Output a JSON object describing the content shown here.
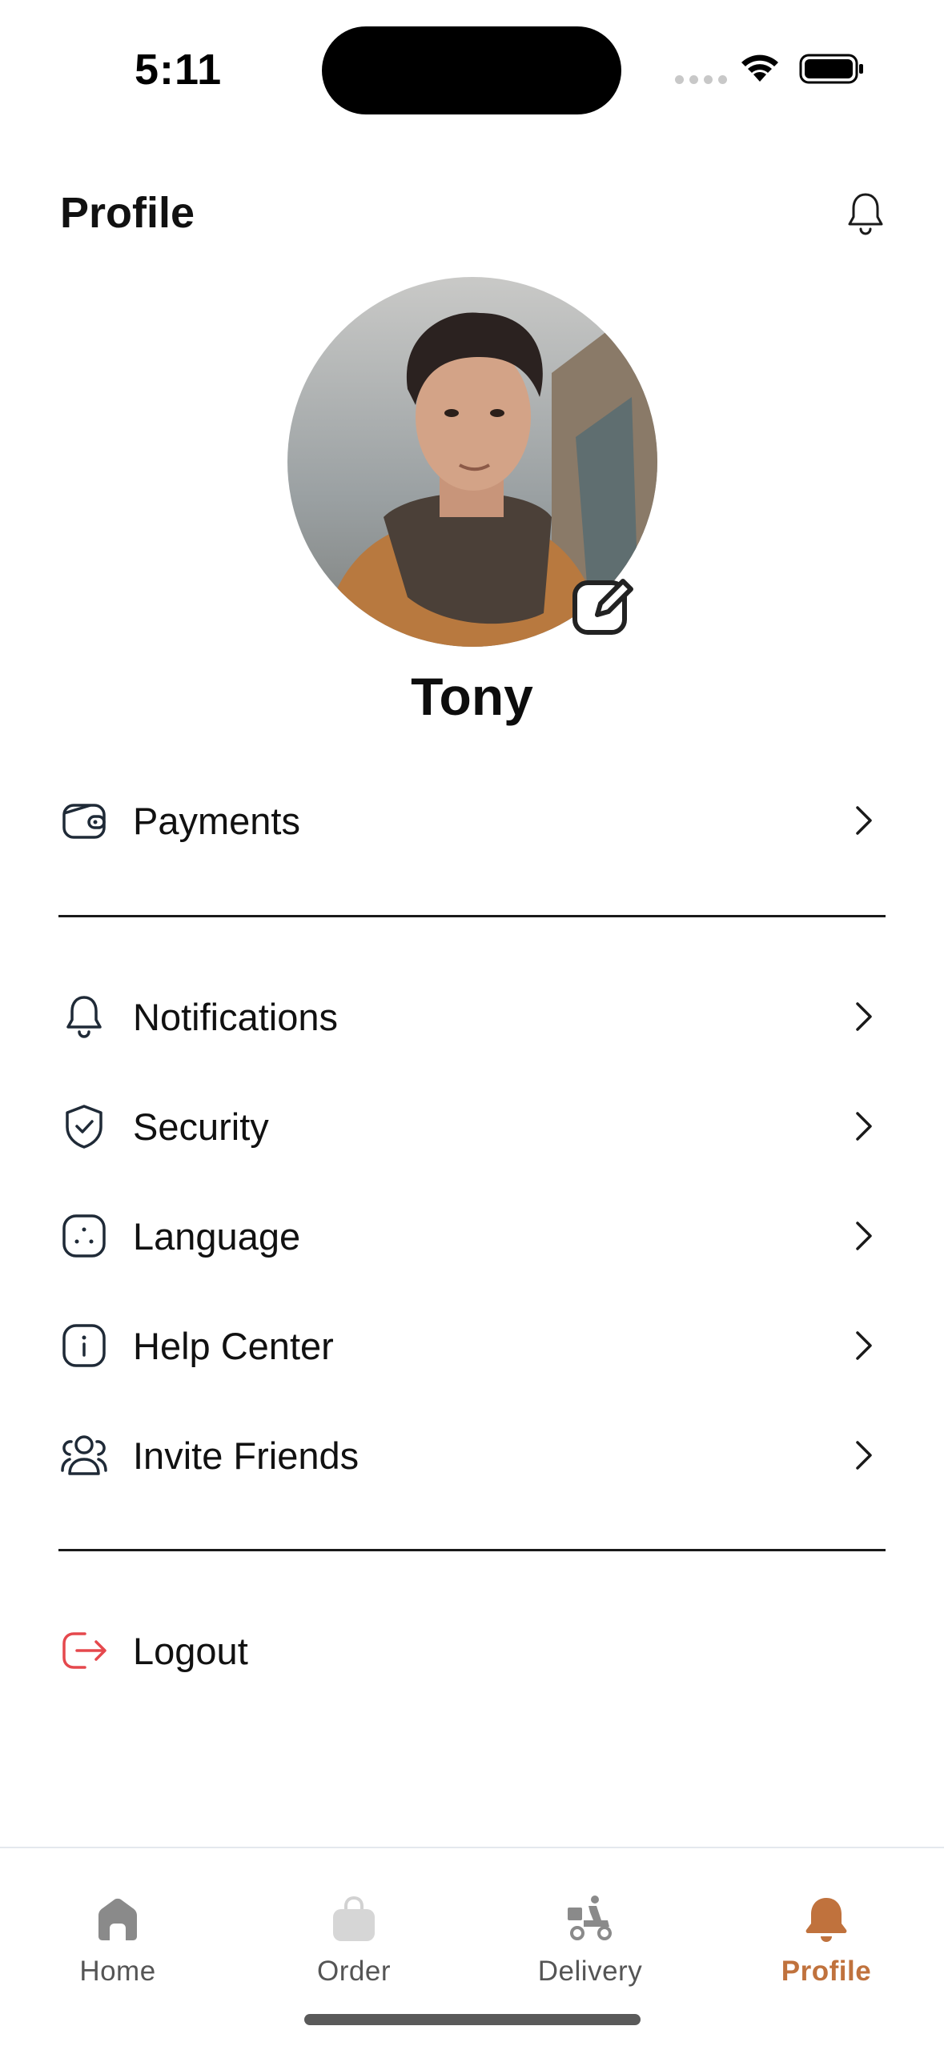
{
  "status_bar": {
    "time": "5:11"
  },
  "header": {
    "title": "Profile",
    "bell_icon": "bell-icon"
  },
  "profile": {
    "name": "Tony",
    "edit_icon": "edit-icon"
  },
  "menu": {
    "group1": [
      {
        "label": "Payments",
        "icon": "wallet-icon"
      }
    ],
    "group2": [
      {
        "label": "Notifications",
        "icon": "bell-icon"
      },
      {
        "label": "Security",
        "icon": "shield-check-icon"
      },
      {
        "label": "Language",
        "icon": "language-icon"
      },
      {
        "label": "Help Center",
        "icon": "info-icon"
      },
      {
        "label": "Invite Friends",
        "icon": "users-icon"
      }
    ],
    "logout": {
      "label": "Logout",
      "icon": "logout-icon",
      "color": "#e5484d"
    }
  },
  "tabs": [
    {
      "label": "Home",
      "icon": "home-icon",
      "active": false
    },
    {
      "label": "Order",
      "icon": "bag-icon",
      "active": false
    },
    {
      "label": "Delivery",
      "icon": "scooter-icon",
      "active": false
    },
    {
      "label": "Profile",
      "icon": "bell-filled-icon",
      "active": true
    }
  ],
  "colors": {
    "accent": "#c0723d",
    "logout": "#e5484d",
    "icon_dark": "#1f2a37",
    "tab_inactive": "#8a8a8a"
  }
}
